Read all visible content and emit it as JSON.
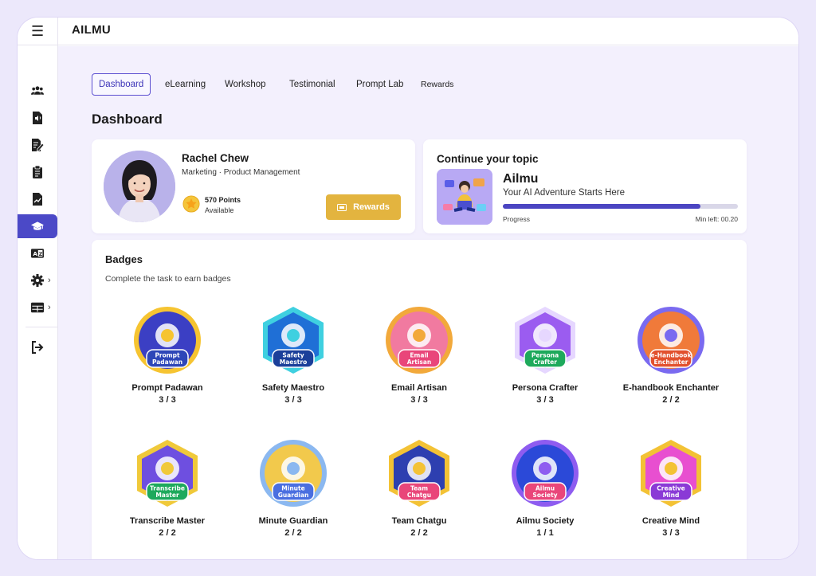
{
  "app": {
    "title": "AILMU"
  },
  "tabs": [
    {
      "label": "Dashboard",
      "active": true
    },
    {
      "label": "eLearning"
    },
    {
      "label": "Workshop"
    },
    {
      "label": "Testimonial"
    },
    {
      "label": "Prompt Lab"
    },
    {
      "label": "Rewards"
    }
  ],
  "page_title": "Dashboard",
  "profile": {
    "name": "Rachel Chew",
    "role": "Marketing · Product Management",
    "points": "570 Points",
    "points_sub": "Available",
    "rewards_button": "Rewards"
  },
  "topic": {
    "heading": "Continue your topic",
    "name": "Ailmu",
    "subtitle": "Your AI Adventure Starts Here",
    "progress_label": "Progress",
    "progress_fraction": 0.84,
    "min_left": "Min left: 00.20"
  },
  "badges": {
    "title": "Badges",
    "subtitle": "Complete the task to earn badges",
    "items": [
      {
        "name": "Prompt Padawan",
        "count": "3 / 3",
        "label1": "Prompt",
        "label2": "Padawan",
        "color": "#3b3fc4",
        "accent": "#f6c431",
        "ribbon": "#2e46b8"
      },
      {
        "name": "Safety Maestro",
        "count": "3 / 3",
        "label1": "Safety",
        "label2": "Maestro",
        "color": "#1f6fd6",
        "accent": "#3fd0e0",
        "ribbon": "#1b3f9a"
      },
      {
        "name": "Email Artisan",
        "count": "3 / 3",
        "label1": "Email",
        "label2": "Artisan",
        "color": "#f17aa0",
        "accent": "#f2a93b",
        "ribbon": "#e9467a"
      },
      {
        "name": "Persona Crafter",
        "count": "3 / 3",
        "label1": "Persona",
        "label2": "Crafter",
        "color": "#9b5cf0",
        "accent": "#e6d7ff",
        "ribbon": "#1ea95c"
      },
      {
        "name": "E-handbook Enchanter",
        "count": "2 / 2",
        "label1": "e-Handbook",
        "label2": "Enchanter",
        "color": "#f07a3a",
        "accent": "#7a6af0",
        "ribbon": "#e2512e"
      },
      {
        "name": "Transcribe Master",
        "count": "2 / 2",
        "label1": "Transcribe",
        "label2": "Master",
        "color": "#6e4fe0",
        "accent": "#f0c93a",
        "ribbon": "#1ea95c"
      },
      {
        "name": "Minute Guardian",
        "count": "2 / 2",
        "label1": "Minute",
        "label2": "Guardian",
        "color": "#f2c94c",
        "accent": "#8bb8f0",
        "ribbon": "#4a6fe0"
      },
      {
        "name": "Team Chatgu",
        "count": "2 / 2",
        "label1": "Team",
        "label2": "Chatgu",
        "color": "#2d3fb0",
        "accent": "#f3c235",
        "ribbon": "#e9467a"
      },
      {
        "name": "Ailmu Society",
        "count": "1 / 1",
        "label1": "Ailmu",
        "label2": "Society",
        "color": "#2b49d8",
        "accent": "#8e5cf0",
        "ribbon": "#e9467a"
      },
      {
        "name": "Creative Mind",
        "count": "3 / 3",
        "label1": "Creative",
        "label2": "Mind",
        "color": "#e84fd0",
        "accent": "#f3c235",
        "ribbon": "#8a3ad6"
      }
    ]
  }
}
